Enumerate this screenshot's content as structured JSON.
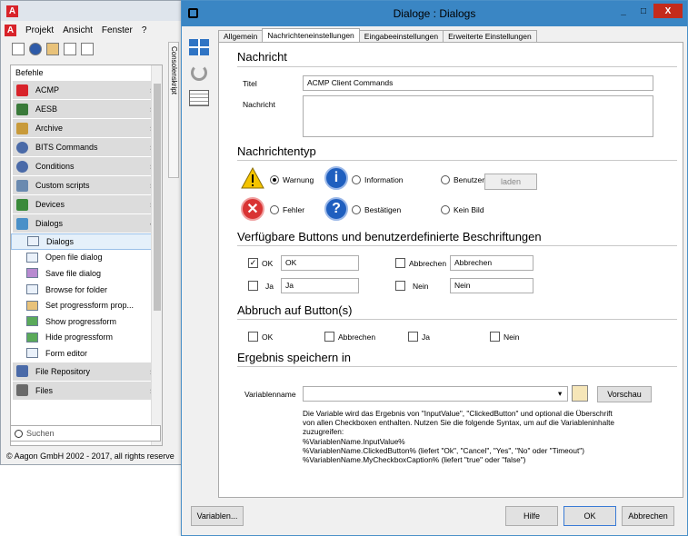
{
  "background_window": {
    "logo_letter": "A",
    "menu": [
      "Projekt",
      "Ansicht",
      "Fenster",
      "?"
    ],
    "panel_header": "Befehle",
    "categories_top": [
      {
        "label": "ACMP",
        "color": "#d8232a"
      },
      {
        "label": "AESB",
        "color": "#3a7a3a"
      },
      {
        "label": "Archive",
        "color": "#c89a3a"
      },
      {
        "label": "BITS Commands",
        "color": "#4a6aa8"
      },
      {
        "label": "Conditions",
        "color": "#4a6aa8"
      },
      {
        "label": "Custom scripts",
        "color": "#6a8ab0"
      },
      {
        "label": "Devices",
        "color": "#3a8a3a"
      },
      {
        "label": "Dialogs",
        "color": "#4a90c8"
      }
    ],
    "dialog_items": [
      "Dialogs",
      "Open file dialog",
      "Save file dialog",
      "Browse for folder",
      "Set progressform prop...",
      "Show progressform",
      "Hide progressform",
      "Form editor"
    ],
    "categories_bottom": [
      {
        "label": "File Repository",
        "color": "#4a6aa8"
      },
      {
        "label": "Files",
        "color": "#6a6a6a"
      }
    ],
    "search_placeholder": "Suchen",
    "copyright": "© Aagon GmbH 2002 - 2017, all rights reserve",
    "vertical_tab": "Consolenskript",
    "chevron_down": "»",
    "chevron_up": "«"
  },
  "dialog": {
    "title": "Dialoge : Dialogs",
    "tabs": [
      "Allgemein",
      "Nachrichteneinstellungen",
      "Eingabeeinstellungen",
      "Erweiterte Einstellungen"
    ],
    "active_tab": "Nachrichteneinstellungen",
    "nachricht": {
      "heading": "Nachricht",
      "titel_label": "Titel",
      "titel_value": "ACMP Client Commands",
      "nachricht_label": "Nachricht",
      "nachricht_value": ""
    },
    "typ": {
      "heading": "Nachrichtentyp",
      "options": [
        "Warnung",
        "Information",
        "Benutzer",
        "Fehler",
        "Bestätigen",
        "Kein Bild"
      ],
      "selected": "Warnung",
      "laden_label": "laden"
    },
    "buttons": {
      "heading": "Verfügbare Buttons und benutzerdefinierte Beschriftungen",
      "rows": [
        {
          "label": "OK",
          "checked": true,
          "value": "OK"
        },
        {
          "label": "Abbrechen",
          "checked": false,
          "value": "Abbrechen"
        },
        {
          "label": "Ja",
          "checked": false,
          "value": "Ja"
        },
        {
          "label": "Nein",
          "checked": false,
          "value": "Nein"
        }
      ]
    },
    "abbruch": {
      "heading": "Abbruch auf Button(s)",
      "options": [
        "OK",
        "Abbrechen",
        "Ja",
        "Nein"
      ]
    },
    "ergebnis": {
      "heading": "Ergebnis speichern in",
      "var_label": "Variablenname",
      "var_value": "",
      "vorschau_label": "Vorschau",
      "hint": "Die Variable wird das Ergebnis von \"InputValue\", \"ClickedButton\" und optional die Überschrift\nvon allen Checkboxen enthalten. Nutzen Sie die folgende Syntax, um auf die Variableninhalte\nzuzugreifen:\n%VariablenName.InputValue%\n%VariablenName.ClickedButton% (liefert \"Ok\", \"Cancel\", \"Yes\", \"No\" oder \"Timeout\")\n%VariablenName.MyCheckboxCaption% (liefert \"true\" oder \"false\")"
    },
    "footer": {
      "variablen": "Variablen...",
      "hilfe": "Hilfe",
      "ok": "OK",
      "abbrechen": "Abbrechen"
    },
    "window_buttons": {
      "minimize": "_",
      "maximize": "□",
      "close": "X"
    }
  }
}
